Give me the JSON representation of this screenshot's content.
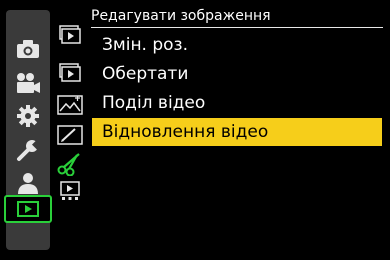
{
  "title": "Редагувати зображення",
  "menu": {
    "items": [
      {
        "label": "Змін. роз."
      },
      {
        "label": "Обертати"
      },
      {
        "label": "Поділ відео"
      },
      {
        "label": "Відновлення відео"
      }
    ],
    "selected_index": 3
  },
  "categories": [
    {
      "icon": "camera-icon"
    },
    {
      "icon": "video-camera-icon"
    },
    {
      "icon": "gear-icon"
    },
    {
      "icon": "wrench-icon"
    },
    {
      "icon": "person-icon"
    },
    {
      "icon": "playback-icon",
      "active": true
    }
  ],
  "subtabs": [
    {
      "icon": "playback-mode-icon"
    },
    {
      "icon": "playback-mode-2-icon"
    },
    {
      "icon": "image-process-icon"
    },
    {
      "icon": "edit-image-icon"
    },
    {
      "icon": "scissors-icon",
      "active": true
    },
    {
      "icon": "playback-settings-icon"
    }
  ],
  "colors": {
    "highlight": "#f6ce1a",
    "active_green": "#2ad03a",
    "category_bg": "#3a3a3a"
  }
}
